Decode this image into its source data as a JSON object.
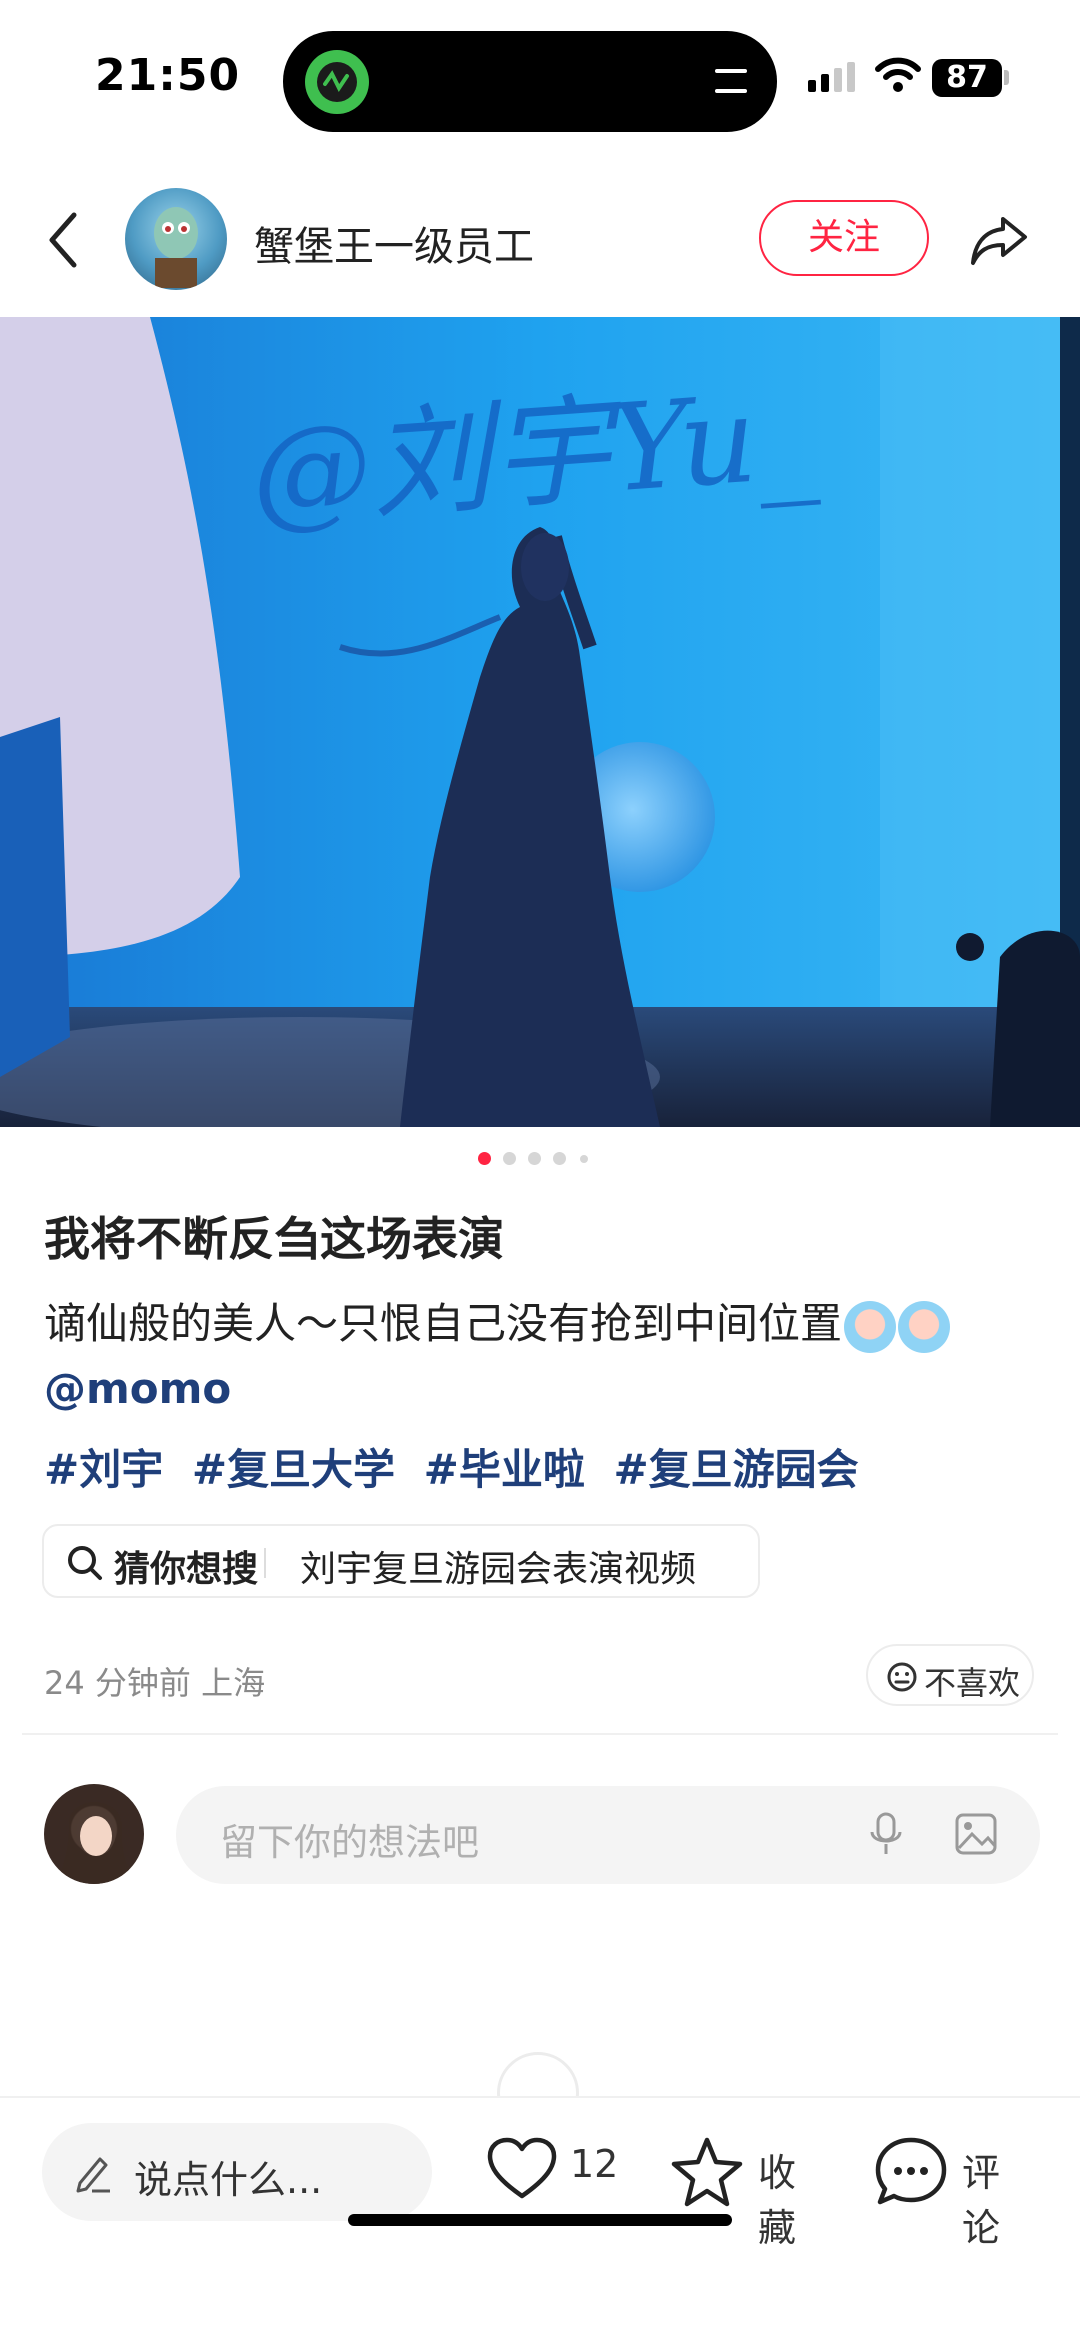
{
  "status_bar": {
    "time": "21:50",
    "battery": "87",
    "icons": [
      "cellular-signal-icon",
      "wifi-icon",
      "battery-icon"
    ],
    "island_app_icon": "activity-app-icon",
    "island_menu_icon": "equals-icon"
  },
  "header": {
    "back_icon": "chevron-left-icon",
    "author_name": "蟹堡王一级员工",
    "follow_label": "关注",
    "share_icon": "share-arrow-icon"
  },
  "post": {
    "image_overlay_text": "@刘宇Yu_",
    "image_count": 5,
    "current_image": 1,
    "title": "我将不断反刍这场表演",
    "description": "谪仙般的美人～只恨自己没有抢到中间位置",
    "mention": "@momo",
    "tags": [
      "#刘宇",
      "#复旦大学",
      "#毕业啦",
      "#复旦游园会"
    ],
    "search_label": "猜你想搜",
    "search_query": "刘宇复旦游园会表演视频",
    "meta": "24 分钟前  上海",
    "dislike_label": "不喜欢"
  },
  "comment_box": {
    "placeholder": "留下你的想法吧"
  },
  "bottom_bar": {
    "say_label": "说点什么...",
    "like_count": "12",
    "favorite_label": "收藏",
    "comment_label": "评论"
  },
  "colors": {
    "accent": "#ff2442",
    "link": "#1f3f7a",
    "muted": "#8a8a8a"
  }
}
